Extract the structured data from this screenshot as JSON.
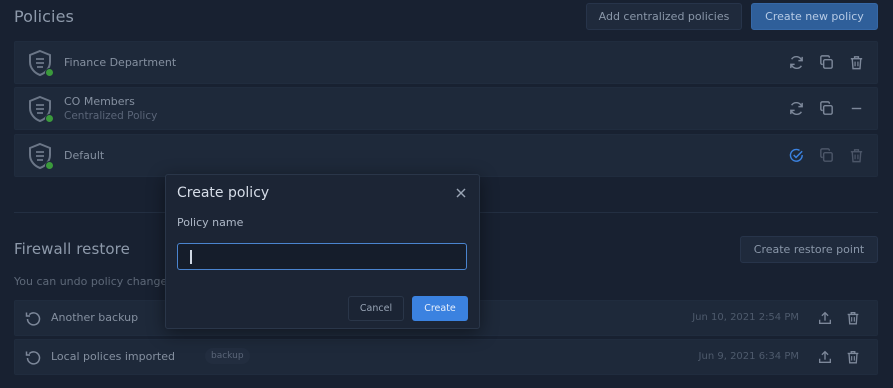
{
  "header": {
    "title": "Policies",
    "add_centralized_label": "Add centralized policies",
    "create_new_label": "Create new policy"
  },
  "policies": [
    {
      "name": "Finance Department",
      "subtitle": "",
      "status_color": "#3b9a3c"
    },
    {
      "name": "CO Members",
      "subtitle": "Centralized Policy",
      "status_color": "#3b9a3c"
    },
    {
      "name": "Default",
      "subtitle": "",
      "status_color": "#3b9a3c"
    }
  ],
  "firewall": {
    "title": "Firewall restore",
    "create_restore_label": "Create restore point",
    "description": "You can undo policy change"
  },
  "backups": [
    {
      "name": "Another backup",
      "tag": "",
      "date": "Jun 10, 2021 2:54 PM"
    },
    {
      "name": "Local polices imported",
      "tag": "backup",
      "date": "Jun 9, 2021 6:34 PM"
    }
  ],
  "modal": {
    "title": "Create policy",
    "field_label": "Policy name",
    "input_value": "",
    "cancel_label": "Cancel",
    "create_label": "Create"
  },
  "colors": {
    "accent": "#3b82e0",
    "status_online": "#3b9a3c",
    "background": "#1b2535"
  }
}
